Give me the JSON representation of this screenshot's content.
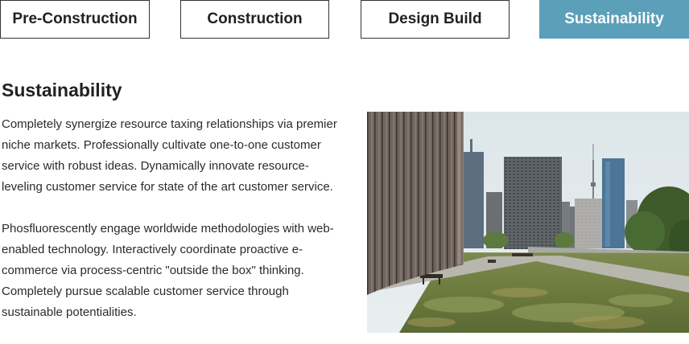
{
  "tabs": [
    {
      "label": "Pre-Construction",
      "active": false
    },
    {
      "label": "Construction",
      "active": false
    },
    {
      "label": "Design Build",
      "active": false
    },
    {
      "label": "Sustainability",
      "active": true
    }
  ],
  "colors": {
    "accent": "#5b9fb9"
  },
  "content": {
    "heading": "Sustainability",
    "paragraphs": [
      "Completely synergize resource taxing relationships via premier niche markets. Professionally cultivate one-to-one customer service with robust ideas. Dynamically innovate resource-leveling customer service for state of the art customer service.",
      "Phosfluorescently engage worldwide methodologies with web-enabled technology. Interactively coordinate proactive e-commerce via process-centric \"outside the box\" thinking. Completely pursue scalable customer service through sustainable potentialities."
    ]
  }
}
